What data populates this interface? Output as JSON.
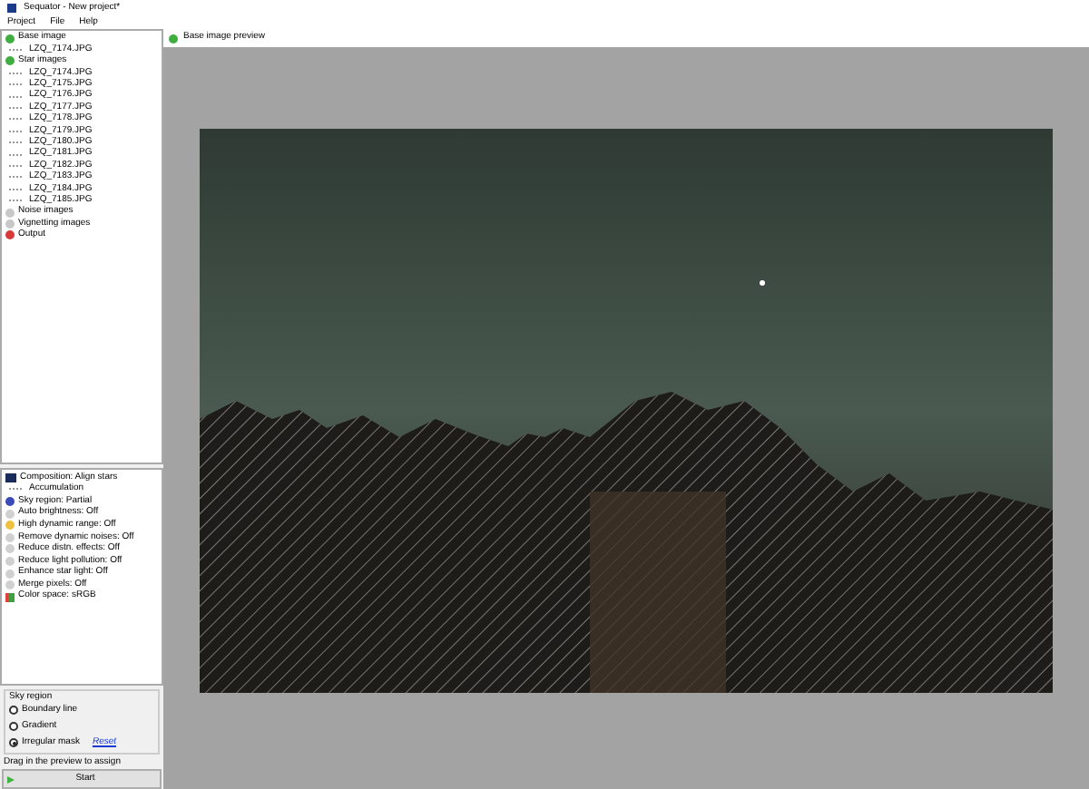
{
  "window": {
    "title": "Sequator - New project*"
  },
  "menu": [
    "Project",
    "File",
    "Help"
  ],
  "tree": [
    {
      "label": "Base image",
      "color": "#3fae3f",
      "children": [
        {
          "label": "LZQ_7174.JPG"
        }
      ]
    },
    {
      "label": "Star images",
      "color": "#3fae3f",
      "children": [
        {
          "label": "LZQ_7174.JPG"
        },
        {
          "label": "LZQ_7175.JPG"
        },
        {
          "label": "LZQ_7176.JPG"
        },
        {
          "label": "LZQ_7177.JPG"
        },
        {
          "label": "LZQ_7178.JPG"
        },
        {
          "label": "LZQ_7179.JPG"
        },
        {
          "label": "LZQ_7180.JPG"
        },
        {
          "label": "LZQ_7181.JPG"
        },
        {
          "label": "LZQ_7182.JPG"
        },
        {
          "label": "LZQ_7183.JPG"
        },
        {
          "label": "LZQ_7184.JPG"
        },
        {
          "label": "LZQ_7185.JPG"
        }
      ]
    },
    {
      "label": "Noise images",
      "color": "#c8c8c8"
    },
    {
      "label": "Vignetting images",
      "color": "#c8c8c8"
    },
    {
      "label": "Output",
      "color": "#d83a3a"
    }
  ],
  "settings": [
    {
      "label": "Composition: Align stars",
      "kind": "square",
      "color": "#1a2a5a",
      "children": [
        {
          "label": "Accumulation"
        }
      ]
    },
    {
      "label": "Sky region: Partial",
      "kind": "dot",
      "color": "#3a4ab8"
    },
    {
      "label": "Auto brightness: Off",
      "kind": "dot",
      "color": "#d0d0d0"
    },
    {
      "label": "High dynamic range: Off",
      "kind": "dot",
      "color": "#f0c040"
    },
    {
      "label": "Remove dynamic noises: Off",
      "kind": "dot",
      "color": "#d0d0d0"
    },
    {
      "label": "Reduce distn. effects: Off",
      "kind": "dot",
      "color": "#d0d0d0"
    },
    {
      "label": "Reduce light pollution: Off",
      "kind": "dot",
      "color": "#d0d0d0"
    },
    {
      "label": "Enhance star light: Off",
      "kind": "dot",
      "color": "#d0d0d0"
    },
    {
      "label": "Merge pixels: Off",
      "kind": "dot",
      "color": "#d0d0d0"
    },
    {
      "label": "Color space: sRGB",
      "kind": "palette",
      "color": "#40a040"
    }
  ],
  "sky_region": {
    "title": "Sky region",
    "options": [
      {
        "label": "Boundary line",
        "selected": false
      },
      {
        "label": "Gradient",
        "selected": false
      },
      {
        "label": "Irregular mask",
        "selected": true
      }
    ],
    "reset_link": "Reset",
    "hint": "Drag in the preview to assign"
  },
  "start_button": "Start",
  "preview": {
    "title": "Base image preview"
  }
}
